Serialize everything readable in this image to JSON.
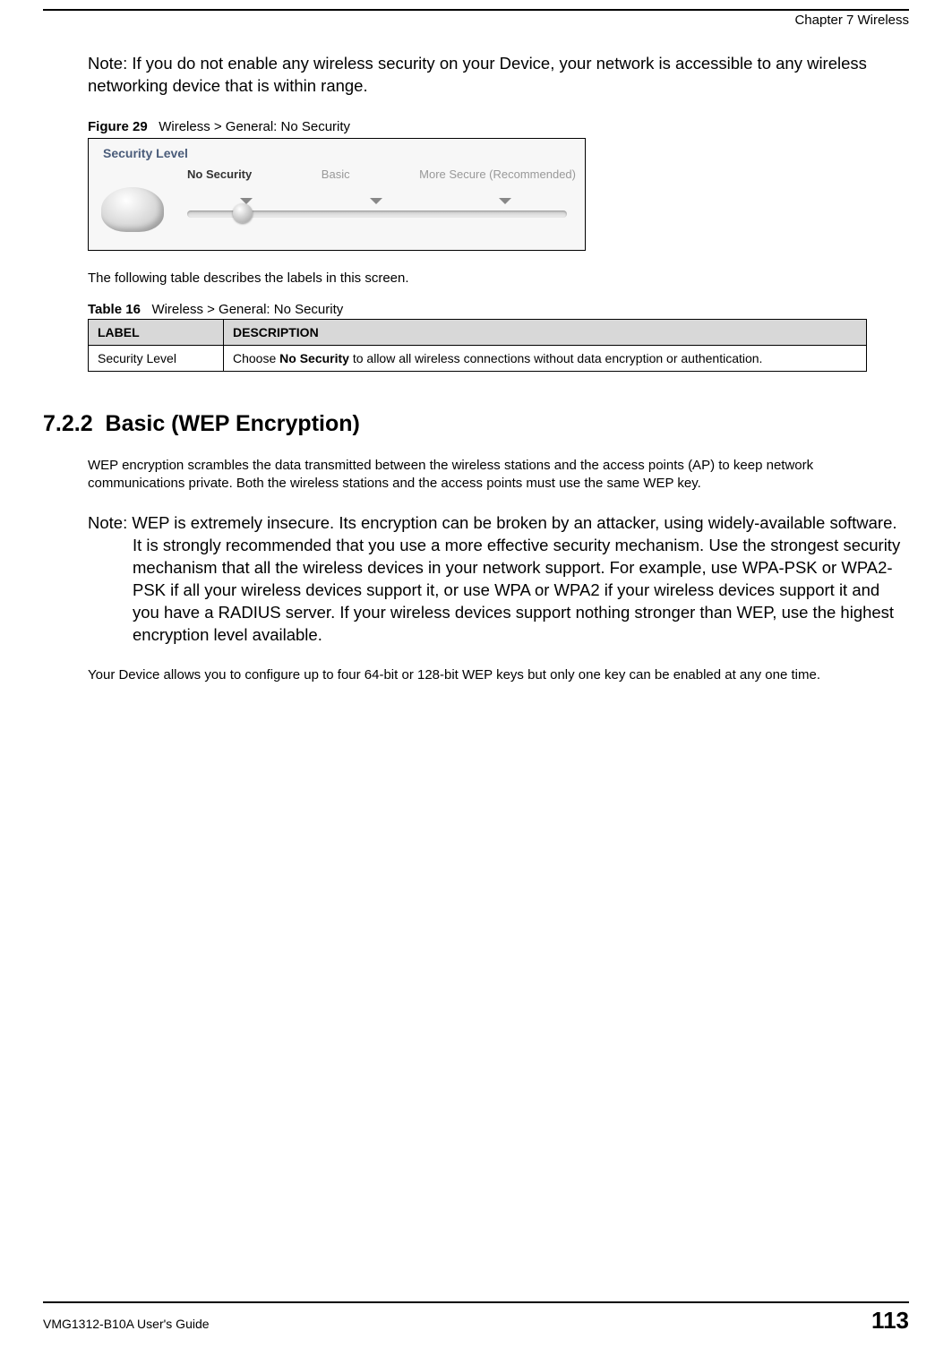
{
  "header": {
    "chapter": "Chapter 7 Wireless"
  },
  "note1": {
    "label": "Note:",
    "text": "If you do not enable any wireless security on your Device, your network is accessible to any wireless networking device that is within range."
  },
  "figure": {
    "label": "Figure 29",
    "caption": "Wireless > General: No Security",
    "panel_title": "Security Level",
    "slider_labels": {
      "no_security": "No Security",
      "basic": "Basic",
      "more_secure": "More Secure (Recommended)"
    }
  },
  "intro_text": "The following table describes the labels in this screen.",
  "table": {
    "label": "Table 16",
    "caption": "Wireless > General: No Security",
    "headers": {
      "col1": "LABEL",
      "col2": "DESCRIPTION"
    },
    "rows": [
      {
        "label": "Security Level",
        "desc_pre": "Choose ",
        "desc_bold": "No Security",
        "desc_post": " to allow all wireless connections without data encryption or authentication."
      }
    ]
  },
  "section": {
    "number": "7.2.2",
    "title": "Basic (WEP Encryption)"
  },
  "para1": "WEP encryption scrambles the data transmitted between the wireless stations and the access points (AP) to keep network communications private. Both the wireless stations and the access points must use the same WEP key.",
  "note2": {
    "label": "Note:",
    "text": "WEP is extremely insecure. Its encryption can be broken by an attacker, using widely-available software. It is strongly recommended that you use a more effective security mechanism. Use the strongest security mechanism that all the wireless devices in your network support. For example, use WPA-PSK or WPA2-PSK if all your wireless devices support it, or use WPA or WPA2 if your wireless devices support it and you have a RADIUS server. If your wireless devices support nothing stronger than WEP, use the highest encryption level available."
  },
  "para2": "Your Device allows you to configure up to four 64-bit or 128-bit WEP keys but only one key can be enabled at any one time.",
  "footer": {
    "guide": "VMG1312-B10A User's Guide",
    "page": "113"
  }
}
